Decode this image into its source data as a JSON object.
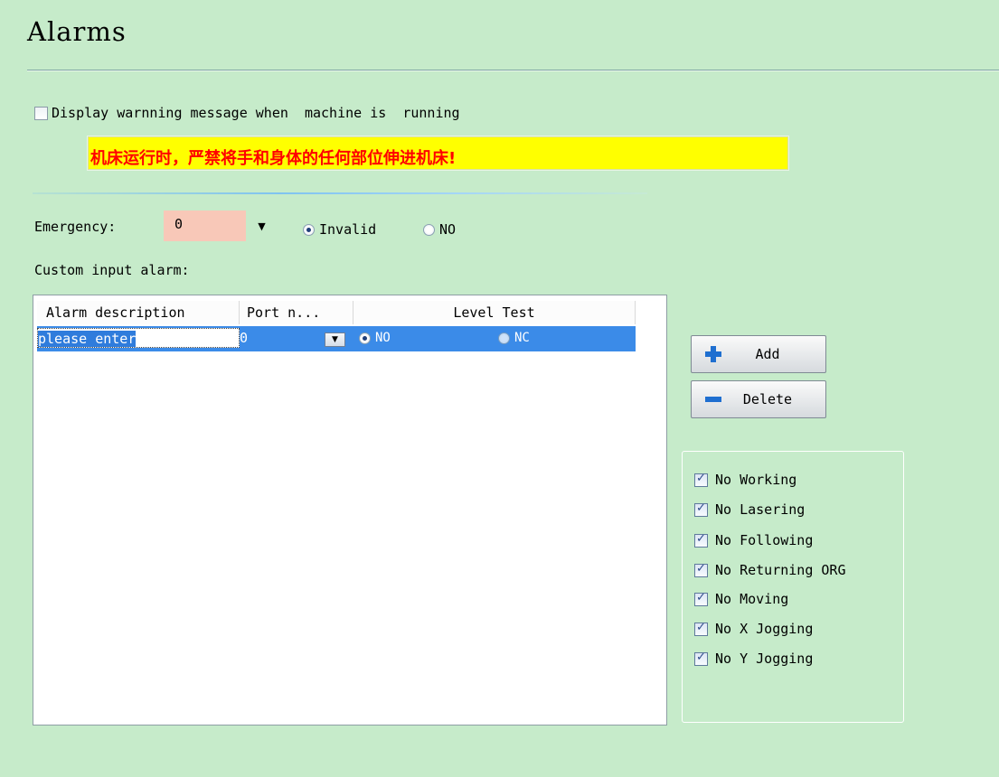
{
  "page": {
    "title": "Alarms"
  },
  "warning": {
    "checkbox_label": "Display warnning message when  machine is  running",
    "checked": false,
    "message": "机床运行时，严禁将手和身体的任何部位伸进机床!"
  },
  "emergency": {
    "label": "Emergency:",
    "value": "0",
    "options": {
      "invalid": "Invalid",
      "no": "NO"
    },
    "selected": "Invalid"
  },
  "custom": {
    "label": "Custom input alarm:",
    "columns": [
      "Alarm description",
      "Port n...",
      "Level Test"
    ],
    "rows": [
      {
        "description": "please enter",
        "port": "0",
        "level_no": "NO",
        "level_nc": "NC",
        "selected_level": "NO"
      }
    ]
  },
  "buttons": {
    "add": "Add",
    "delete": "Delete"
  },
  "options": [
    {
      "label": "No Working",
      "checked": true
    },
    {
      "label": "No Lasering",
      "checked": true
    },
    {
      "label": "No Following",
      "checked": true
    },
    {
      "label": "No Returning ORG",
      "checked": true
    },
    {
      "label": "No Moving",
      "checked": true
    },
    {
      "label": "No X Jogging",
      "checked": true
    },
    {
      "label": "No Y Jogging",
      "checked": true
    }
  ],
  "colors": {
    "background": "#c6ebca",
    "warning_bg": "#ffff00",
    "warning_text": "#ff0000",
    "selection": "#3b8be8",
    "emergency_bg": "#f8c8b8"
  }
}
